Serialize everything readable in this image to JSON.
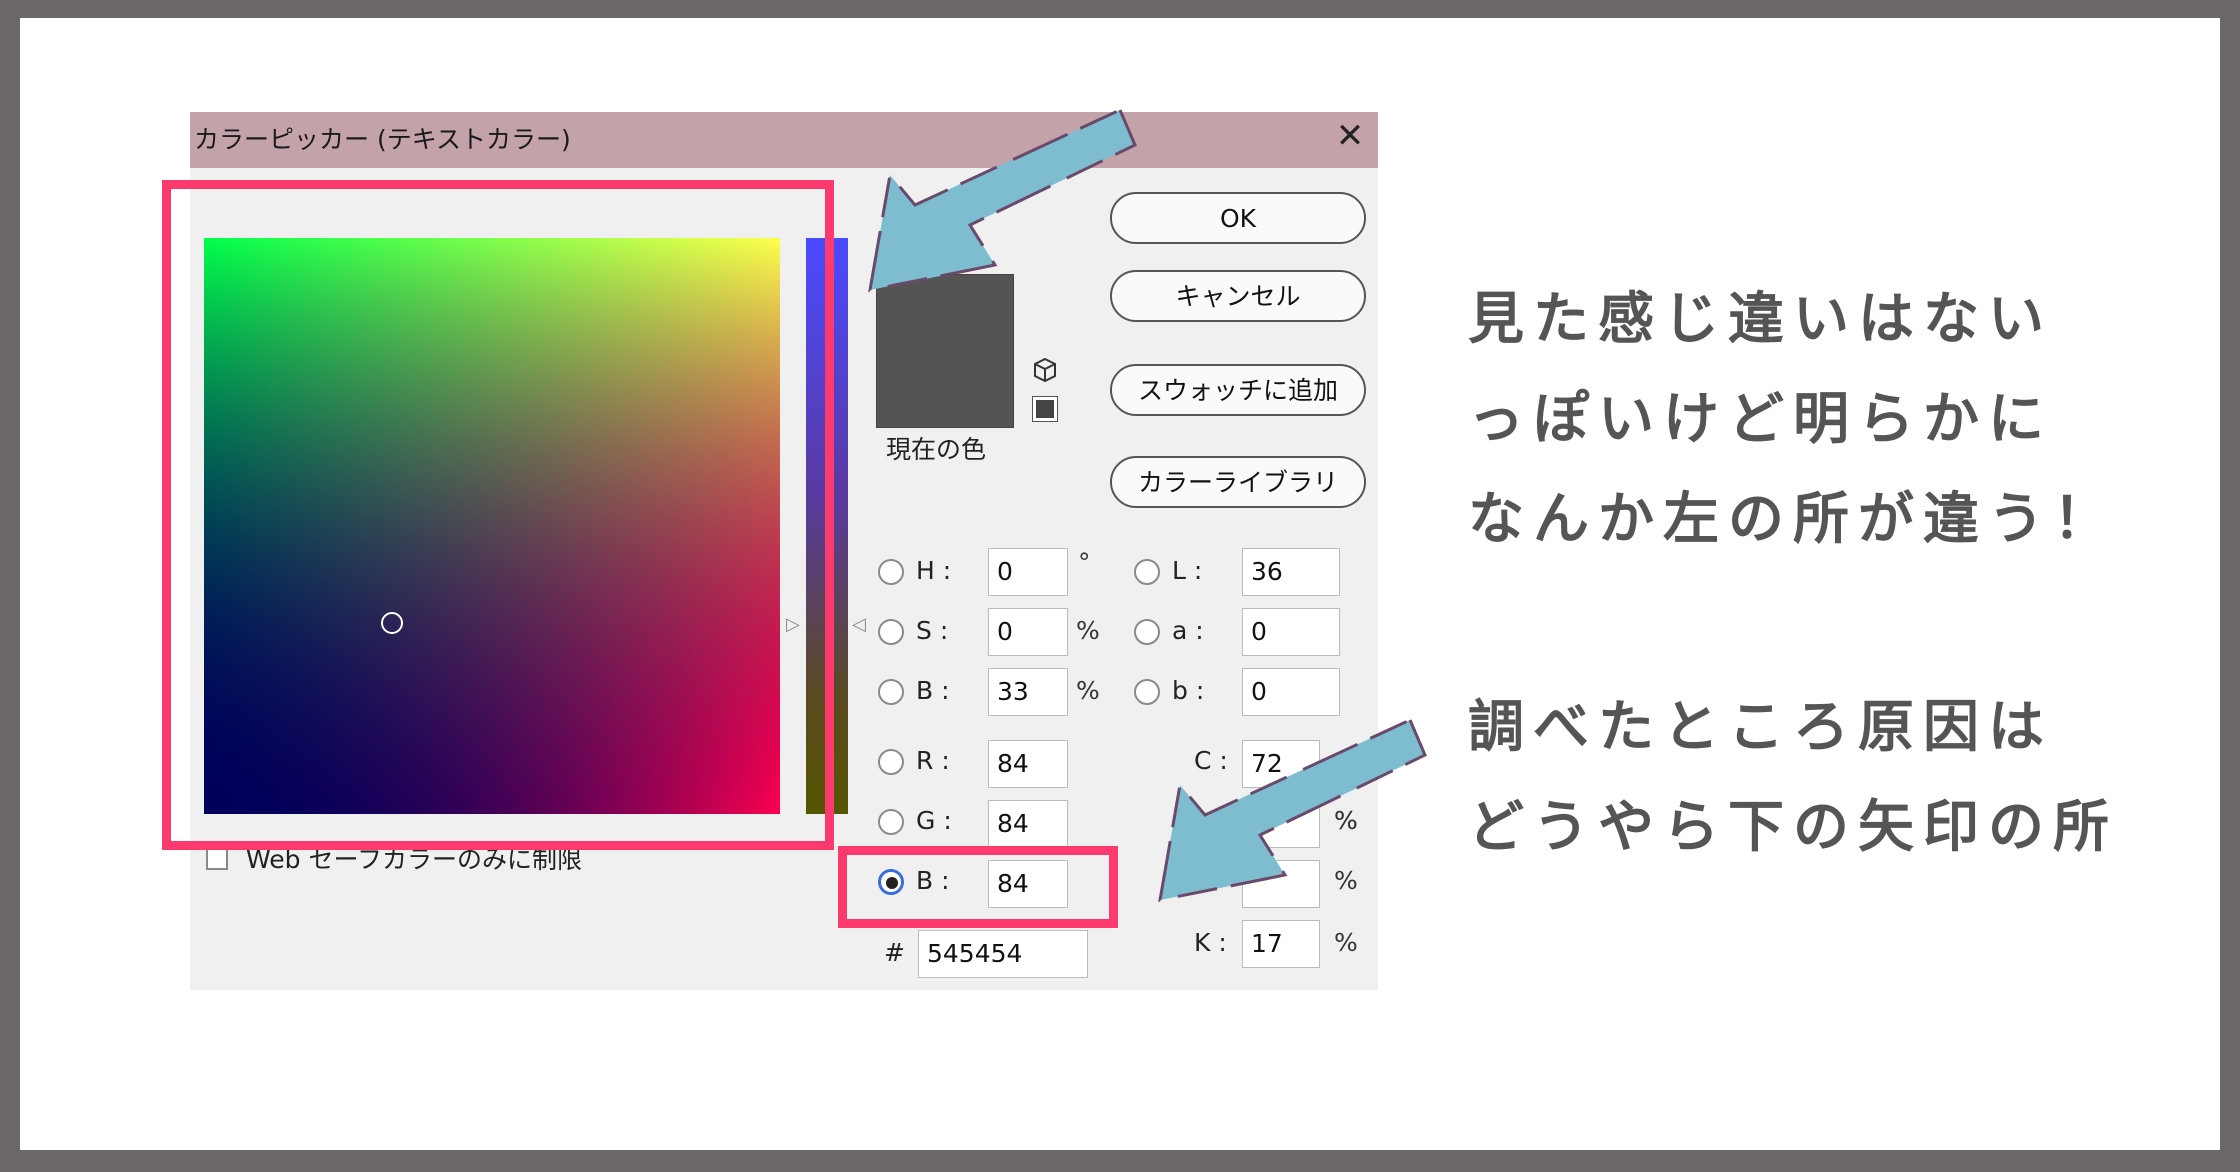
{
  "dialog": {
    "title": "カラーピッカー (テキストカラー)",
    "close": "✕",
    "current_label": "現在の色",
    "current_color": "#545454",
    "buttons": {
      "ok": "OK",
      "cancel": "キャンセル",
      "add_swatch": "スウォッチに追加",
      "color_library": "カラーライブラリ"
    },
    "hsb": {
      "h_label": "H :",
      "h_value": "0",
      "h_unit": "°",
      "s_label": "S :",
      "s_value": "0",
      "s_unit": "%",
      "b_label": "B :",
      "b_value": "33",
      "b_unit": "%"
    },
    "lab": {
      "l_label": "L :",
      "l_value": "36",
      "a_label": "a :",
      "a_value": "0",
      "b_label": "b :",
      "b_value": "0"
    },
    "rgb": {
      "r_label": "R :",
      "r_value": "84",
      "g_label": "G :",
      "g_value": "84",
      "b_label": "B :",
      "b_value": "84",
      "selected": "B"
    },
    "cmyk": {
      "c_label": "C :",
      "c_value": "72",
      "c_unit": "%",
      "m_unit": "%",
      "y_unit": "%",
      "k_label": "K :",
      "k_value": "17",
      "k_unit": "%"
    },
    "hex_label": "#",
    "hex_value": "545454",
    "websafe_label": "Web セーフカラーのみに制限"
  },
  "annotations": {
    "line1": "見た感じ違いはない",
    "line2": "っぽいけど明らかに",
    "line3": "なんか左の所が違う！",
    "line4": "調べたところ原因は",
    "line5": "どうやら下の矢印の所",
    "highlight_color": "#fd3a6e",
    "arrow_color": "#7ebdd0"
  }
}
